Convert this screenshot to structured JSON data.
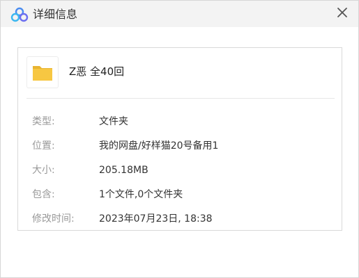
{
  "window": {
    "title": "详细信息",
    "close_glyph": "✕"
  },
  "icons": {
    "app": "cloud-logo-icon",
    "close": "close-icon",
    "item": "folder-icon"
  },
  "colors": {
    "folder": "#f7c742",
    "folder_dark": "#e9b431",
    "logo_blue": "#4a8cf0"
  },
  "item": {
    "name": "Z恶 全40回"
  },
  "details": {
    "type": {
      "label": "类型:",
      "value": "文件夹"
    },
    "location": {
      "label": "位置:",
      "value": "我的网盘/好样猫20号备用1"
    },
    "size": {
      "label": "大小:",
      "value": "205.18MB"
    },
    "contains": {
      "label": "包含:",
      "value": "1个文件,0个文件夹"
    },
    "modified": {
      "label": "修改时间:",
      "value": "2023年07月23日, 18:38"
    }
  }
}
